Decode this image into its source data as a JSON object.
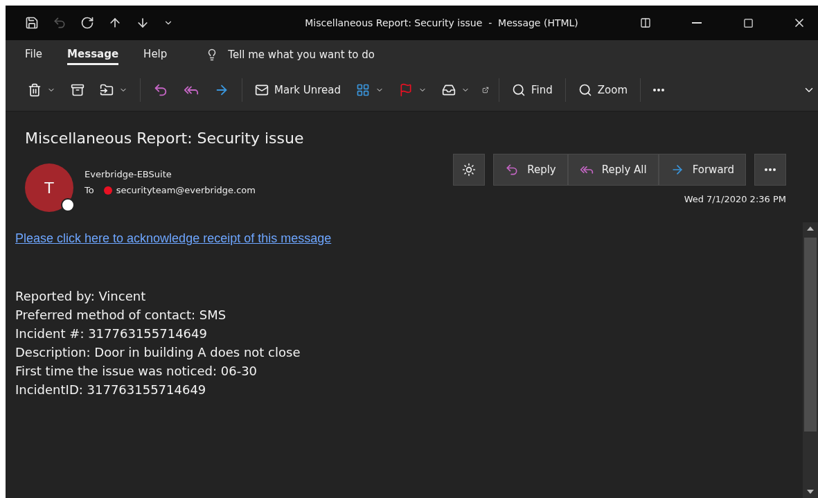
{
  "window": {
    "title": "Miscellaneous Report: Security issue  -  Message (HTML)"
  },
  "tabs": [
    {
      "label": "File",
      "selected": false
    },
    {
      "label": "Message",
      "selected": true
    },
    {
      "label": "Help",
      "selected": false
    }
  ],
  "tell_me": {
    "placeholder": "Tell me what you want to do"
  },
  "toolbar": {
    "mark_unread": "Mark Unread",
    "find": "Find",
    "zoom": "Zoom"
  },
  "message": {
    "subject": "Miscellaneous Report: Security issue",
    "avatar_initial": "T",
    "sender": "Everbridge-EBSuite",
    "to_label": "To",
    "recipient": "securityteam@everbridge.com",
    "date": "Wed 7/1/2020 2:36 PM",
    "actions": [
      {
        "label": "Reply",
        "kind": "reply"
      },
      {
        "label": "Reply All",
        "kind": "reply_all"
      },
      {
        "label": "Forward",
        "kind": "forward"
      }
    ],
    "link": "Please click here to acknowledge receipt of this message",
    "body": [
      "Reported by: Vincent",
      "Preferred method of contact: SMS",
      "Incident #: 317763155714649",
      "Description: Door in building A does not close",
      "First time the issue was noticed: 06-30",
      "IncidentID: 317763155714649"
    ]
  }
}
